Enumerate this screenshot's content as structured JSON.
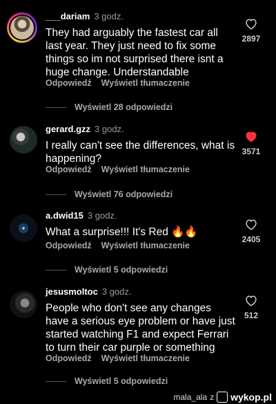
{
  "comments": [
    {
      "username": "___dariam",
      "time": "3 godz.",
      "text": "They had arguably the fastest car all last year. They just need to fix some things so im not surprised there isnt a huge change. Understandable",
      "reply_label": "Odpowiedź",
      "translate_label": "Wyświetl tłumaczenie",
      "replies_label": "Wyświetl 28 odpowiedzi",
      "likes": "2897",
      "liked": false
    },
    {
      "username": "gerard.gzz",
      "time": "3 godz.",
      "text": "I really can't see the differences, what is happening?",
      "reply_label": "Odpowiedź",
      "translate_label": "Wyświetl tłumaczenie",
      "replies_label": "Wyświetl 76 odpowiedzi",
      "likes": "3571",
      "liked": true
    },
    {
      "username": "a.dwid15",
      "time": "3 godz.",
      "text": "What a surprise!!! It's Red 🔥🔥",
      "reply_label": "Odpowiedź",
      "translate_label": "Wyświetl tłumaczenie",
      "replies_label": "Wyświetl 5 odpowiedzi",
      "likes": "2405",
      "liked": false
    },
    {
      "username": "jesusmoltoc",
      "time": "3 godz.",
      "text": "People who don't see any changes have a serious eye problem or have just started watching F1 and expect Ferrari to turn their car purple or something",
      "reply_label": "Odpowiedź",
      "translate_label": "Wyświetl tłumaczenie",
      "replies_label": "Wyświetl 5 odpowiedzi",
      "likes": "512",
      "liked": false
    }
  ],
  "watermark": {
    "user": "mala_ala",
    "z": "z",
    "site": "wykop.pl"
  },
  "colors": {
    "background": "#000000",
    "liked_heart": "#ff3040",
    "muted_text": "#a8a8a8"
  }
}
